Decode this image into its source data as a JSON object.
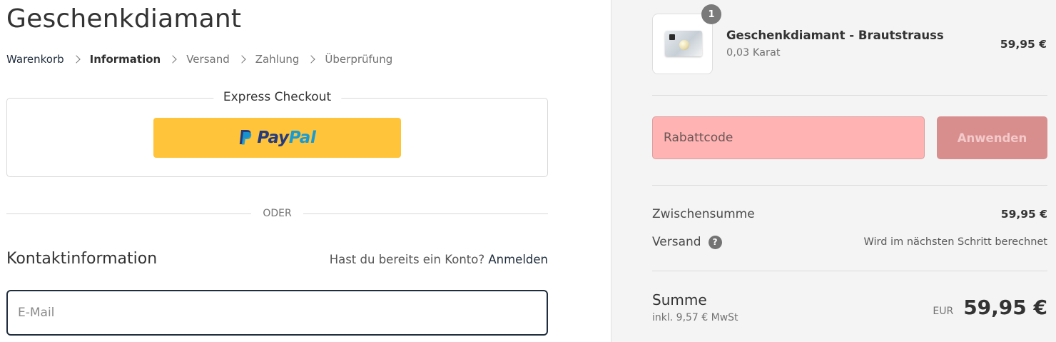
{
  "shop": {
    "title": "Geschenkdiamant"
  },
  "breadcrumb": [
    "Warenkorb",
    "Information",
    "Versand",
    "Zahlung",
    "Überprüfung"
  ],
  "express": {
    "title": "Express Checkout",
    "paypal_part1": "Pay",
    "paypal_part2": "Pal"
  },
  "divider": {
    "label": "ODER"
  },
  "contact": {
    "title": "Kontaktinformation",
    "account_prompt": "Hast du bereits ein Konto?",
    "login_label": "Anmelden",
    "email_placeholder": "E-Mail"
  },
  "order": {
    "item": {
      "quantity": "1",
      "name": "Geschenkdiamant - Brautstrauss",
      "variant": "0,03 Karat",
      "price": "59,95 €"
    },
    "discount": {
      "placeholder": "Rabattcode",
      "apply_label": "Anwenden"
    },
    "subtotal_label": "Zwischensumme",
    "subtotal_value": "59,95 €",
    "shipping_label": "Versand",
    "shipping_value": "Wird im nächsten Schritt berechnet",
    "total_label": "Summe",
    "tax_note": "inkl. 9,57 € MwSt",
    "currency": "EUR",
    "total_value": "59,95 €"
  },
  "colors": {
    "paypal_yellow": "#ffc439",
    "paypal_dark_blue": "#253b80",
    "paypal_light_blue": "#179bd7",
    "discount_field": "#ffb3b3",
    "apply_button": "#d98e8e",
    "focus_border": "#1f2d3d"
  }
}
